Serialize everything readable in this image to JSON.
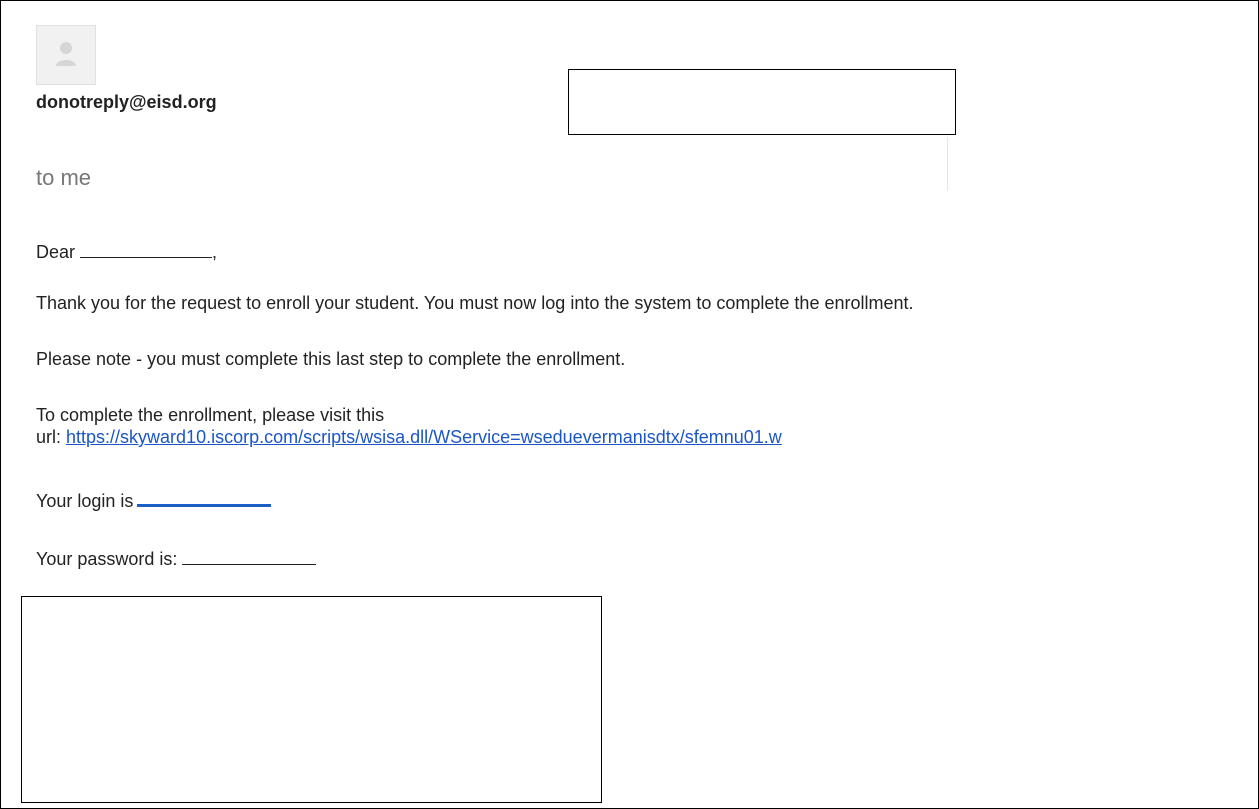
{
  "email": {
    "sender": "donotreply@eisd.org",
    "recipient": "to me",
    "avatar_icon": "person-icon",
    "greeting_prefix": "Dear",
    "greeting_suffix": ",",
    "paragraph_1": "Thank you for the request to enroll your student.  You must now log into the system to complete the enrollment.",
    "paragraph_2": "Please note - you must complete this last step to complete the enrollment.",
    "paragraph_3_line_1": "To complete the enrollment, please visit this",
    "paragraph_3_prefix": "url: ",
    "url": "https://skyward10.iscorp.com/scripts/wsisa.dll/WService=wseduevermanisdtx/sfemnu01.w",
    "login_label": "Your login is",
    "password_label": "Your password is:"
  },
  "colors": {
    "link": "#1a56c8",
    "recipient_gray": "#777777",
    "text": "#222222"
  }
}
